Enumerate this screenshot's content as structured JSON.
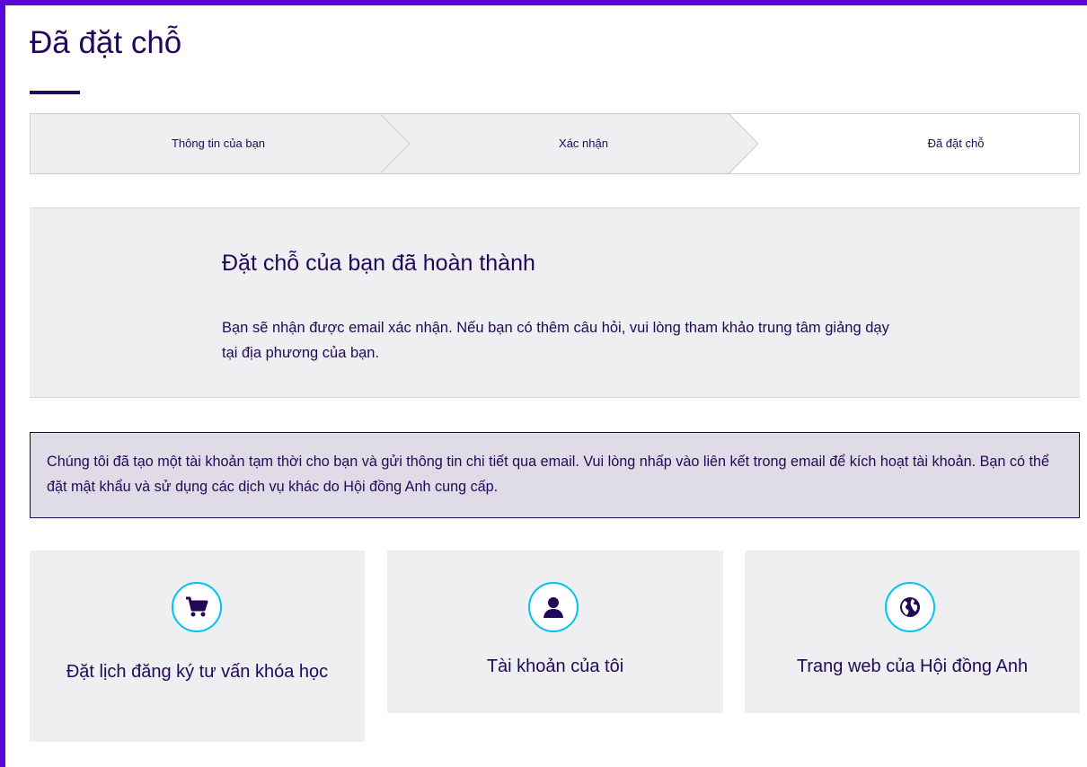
{
  "page": {
    "title": "Đã đặt chỗ"
  },
  "stepper": {
    "steps": [
      {
        "label": "Thông tin của bạn",
        "state": "done"
      },
      {
        "label": "Xác nhận",
        "state": "done"
      },
      {
        "label": "Đã đặt chỗ",
        "state": "current"
      }
    ]
  },
  "success": {
    "title": "Đặt chỗ của bạn đã hoàn thành",
    "text": "Bạn sẽ nhận được email xác nhận. Nếu bạn có thêm câu hỏi, vui lòng tham khảo trung tâm giảng dạy tại địa phương của bạn."
  },
  "notice": {
    "text": "Chúng tôi đã tạo một tài khoản tạm thời cho bạn và gửi thông tin chi tiết qua email. Vui lòng nhấp vào liên kết trong email để kích hoạt tài khoản. Bạn có thể đặt mật khẩu và sử dụng các dịch vụ khác do Hội đồng Anh cung cấp."
  },
  "cards": [
    {
      "label": "Đặt lịch đăng ký tư vấn khóa học",
      "icon": "shopping-cart-icon"
    },
    {
      "label": "Tài khoản của tôi",
      "icon": "user-icon"
    },
    {
      "label": "Trang web của Hội đồng Anh",
      "icon": "globe-icon"
    }
  ],
  "colors": {
    "brand_purple": "#23085a",
    "frame_border": "#5a09d6",
    "panel_bg": "#edeff0",
    "notice_bg": "#e0dce7",
    "icon_ring": "#00c2f3"
  }
}
